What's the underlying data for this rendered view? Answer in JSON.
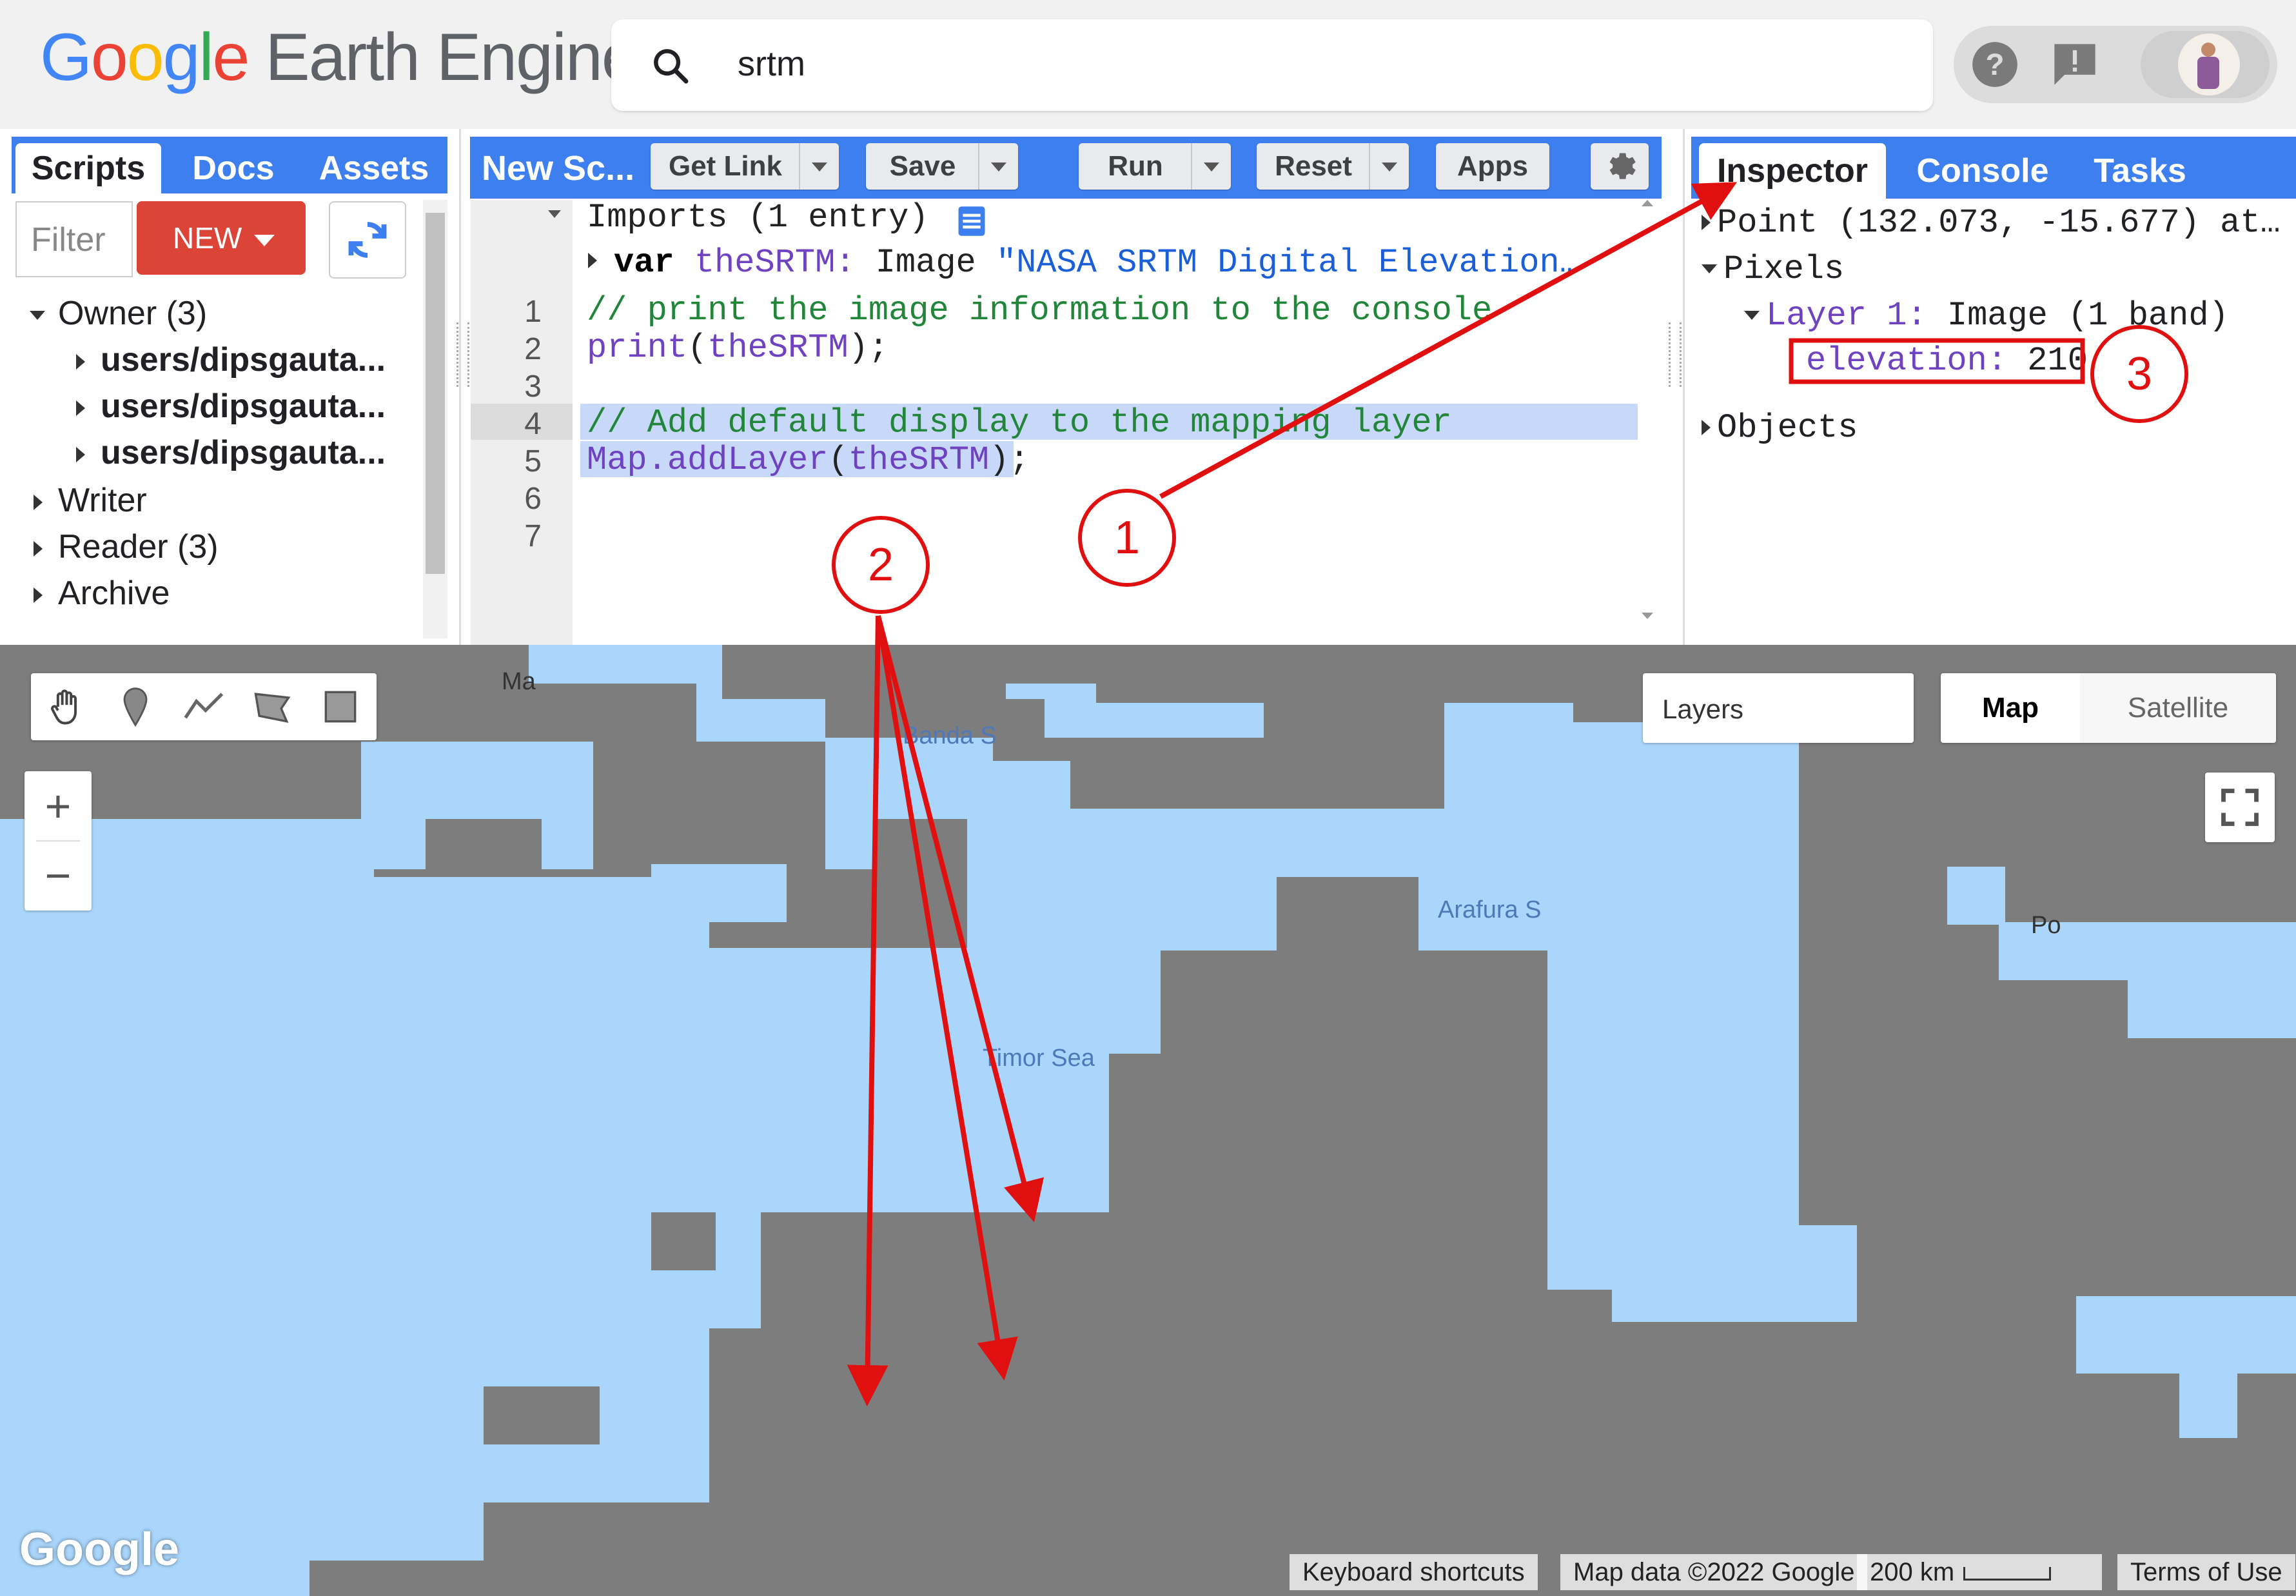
{
  "app": {
    "logo_google": "Google",
    "logo_product": "Earth Engine",
    "search_value": "srtm"
  },
  "left_panel": {
    "tabs": [
      "Scripts",
      "Docs",
      "Assets"
    ],
    "filter_placeholder": "Filter",
    "new_label": "NEW",
    "tree": {
      "owner": "Owner (3)",
      "owner_items": [
        "users/dipsgauta...",
        "users/dipsgauta...",
        "users/dipsgauta..."
      ],
      "writer": "Writer",
      "reader": "Reader (3)",
      "archive": "Archive"
    }
  },
  "editor": {
    "title": "New Sc...",
    "buttons": {
      "get_link": "Get Link",
      "save": "Save",
      "run": "Run",
      "reset": "Reset",
      "apps": "Apps"
    },
    "imports_header": "Imports (1 entry)",
    "import_var_kw": "var",
    "import_var_name": "theSRTM:",
    "import_var_type": "Image",
    "import_var_value": "\"NASA SRTM Digital Elevation…",
    "line_numbers": [
      "1",
      "2",
      "3",
      "4",
      "5",
      "6",
      "7"
    ],
    "lines": {
      "l1": "// print the image information to the console",
      "l2_fn": "print",
      "l2_arg": "theSRTM",
      "l4": "// Add default display to the mapping layer",
      "l5_fn": "Map.addLayer",
      "l5_arg": "theSRTM"
    },
    "highlighted_line": 4
  },
  "right_panel": {
    "tabs": [
      "Inspector",
      "Console",
      "Tasks"
    ],
    "point": "Point (132.073, -15.677) at…",
    "pixels": "Pixels",
    "layer_label": "Layer 1:",
    "layer_type": "Image (1 band)",
    "elevation_key": "elevation:",
    "elevation_value": "210",
    "objects": "Objects"
  },
  "map": {
    "layers_label": "Layers",
    "map_type_selected": "Map",
    "map_type_other": "Satellite",
    "zoom_in": "+",
    "zoom_out": "−",
    "labels": {
      "banda": "Banda S",
      "arafura": "Arafura S",
      "timor": "Timor Sea",
      "ma": "Ma",
      "po": "Po"
    },
    "google_watermark": "Google",
    "footer": {
      "shortcuts": "Keyboard shortcuts",
      "mapdata": "Map data ©2022 Google",
      "scale": "200 km",
      "terms": "Terms of Use"
    },
    "colors": {
      "water": "#aad6fc",
      "land_srtm": "#7d7d7d"
    }
  },
  "annotations": [
    "1",
    "2",
    "3"
  ]
}
